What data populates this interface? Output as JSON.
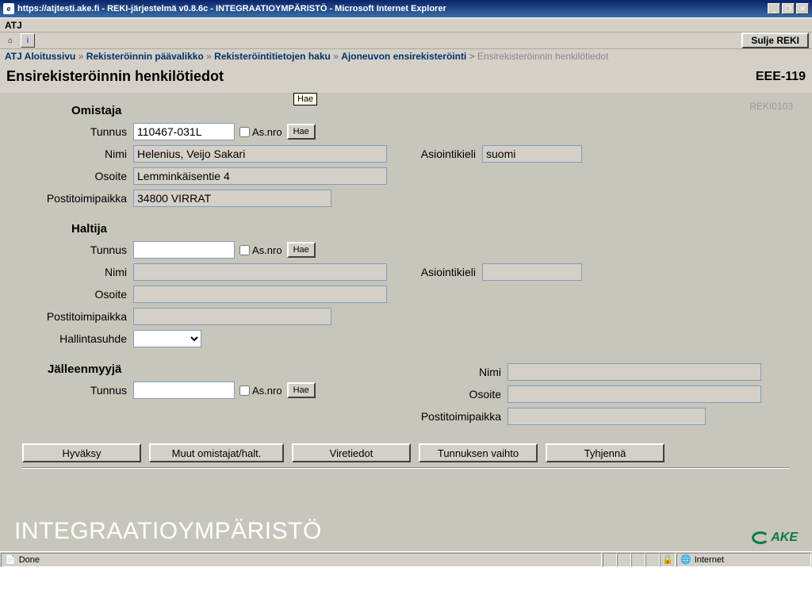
{
  "window": {
    "title": "https://atjtesti.ake.fi - REKI-järjestelmä v0.8.6c - INTEGRAATIOYMPÄRISTÖ - Microsoft Internet Explorer",
    "min": "_",
    "max": "❐",
    "close": "✕"
  },
  "appbar": {
    "label": "ATJ"
  },
  "toolbar": {
    "home": "⌂",
    "info": "i",
    "sulje": "Sulje REKI"
  },
  "breadcrumbs": {
    "items": [
      "ATJ Aloitussivu",
      "Rekisteröinnin päävalikko",
      "Rekisteröintitietojen haku",
      "Ajoneuvon ensirekisteröinti"
    ],
    "current": "Ensirekisteröinnin henkilötiedot",
    "sep": "»"
  },
  "page": {
    "title": "Ensirekisteröinnin henkilötiedot",
    "id": "EEE-119",
    "formcode": "REKI0103"
  },
  "labels": {
    "tunnus": "Tunnus",
    "asnro": "As.nro",
    "hae": "Hae",
    "nimi": "Nimi",
    "asiointikieli": "Asiointikieli",
    "osoite": "Osoite",
    "postitoimipaikka": "Postitoimipaikka",
    "hallintasuhde": "Hallintasuhde"
  },
  "tooltip": {
    "hae": "Hae"
  },
  "omistaja": {
    "heading": "Omistaja",
    "tunnus": "110467-031L",
    "nimi": "Helenius, Veijo Sakari",
    "asiointikieli": "suomi",
    "osoite": "Lemminkäisentie 4",
    "postitoimipaikka": "34800 VIRRAT"
  },
  "haltija": {
    "heading": "Haltija",
    "tunnus": "",
    "nimi": "",
    "asiointikieli": "",
    "osoite": "",
    "postitoimipaikka": "",
    "hallintasuhde": ""
  },
  "jalleenmyyja": {
    "heading": "Jälleenmyyjä",
    "tunnus": "",
    "nimi": "",
    "osoite": "",
    "postitoimipaikka": ""
  },
  "buttons": {
    "hyvaksy": "Hyväksy",
    "muut": "Muut omistajat/halt.",
    "viretiedot": "Viretiedot",
    "tunnuksen": "Tunnuksen vaihto",
    "tyhjenna": "Tyhjennä"
  },
  "env": {
    "label": "INTEGRAATIOYMPÄRISTÖ",
    "ake": "AKE"
  },
  "status": {
    "done": "Done",
    "zone": "Internet"
  }
}
